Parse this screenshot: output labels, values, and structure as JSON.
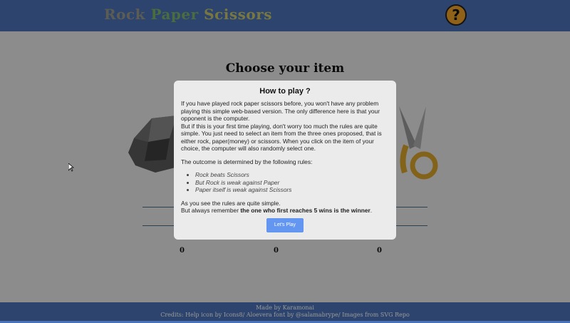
{
  "header": {
    "title_rock": "Rock",
    "title_paper": "Paper",
    "title_scissors": "Scissors",
    "help_label": "?"
  },
  "main": {
    "heading": "Choose your item",
    "scores": [
      "0",
      "0",
      "0"
    ]
  },
  "modal": {
    "title": "How to play ?",
    "p1": "If you have played rock paper scissors before, you won't have any problem playing this simple web-based version. The only difference here is that your opponent is the computer.",
    "p2": "But if this is your first time playing, don't worry too much the rules are quite simple. You just need to select an item from the three ones proposed, that is either rock, paper(money) or scissors. When you click on the item of your choice, the computer will also randomly select one.",
    "p3": "The outcome is determined by the following rules:",
    "rules": [
      "Rock beats Scissors",
      "But Rock is weak against Paper",
      "Paper itself is weak against Scissors"
    ],
    "p4": "As you see the rules are quite simple.",
    "p5_pre": "But always remember ",
    "p5_bold": "the one who first reaches 5 wins is the winner",
    "p5_post": ".",
    "play_button": "Let's Play"
  },
  "footer": {
    "line1": "Made by Karamonai",
    "line2": "Credits: Help icon by Icons8/ Aloevera font by @salamabrype/ Images from SVG Repo"
  },
  "colors": {
    "header_bg": "#4a72b8",
    "play_button": "#6396f0",
    "help_button": "#f0a22a"
  },
  "icons": [
    "help-icon",
    "rock-icon",
    "scissors-icon",
    "cursor-icon"
  ]
}
